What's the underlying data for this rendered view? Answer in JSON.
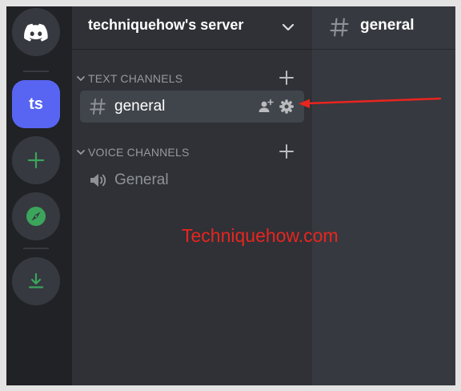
{
  "server_rail": {
    "home_icon": "discord-logo-icon",
    "servers": [
      {
        "abbreviation": "ts",
        "selected": true
      }
    ],
    "add_server_icon": "plus-icon",
    "explore_icon": "compass-icon",
    "download_icon": "download-icon"
  },
  "server": {
    "name": "techniquehow's server",
    "menu_icon": "chevron-down-icon"
  },
  "categories": [
    {
      "label": "TEXT CHANNELS",
      "channels": [
        {
          "name": "general",
          "type": "text",
          "icon": "hash-icon",
          "selected": true,
          "actions": [
            "invite-icon",
            "gear-icon"
          ]
        }
      ]
    },
    {
      "label": "VOICE CHANNELS",
      "channels": [
        {
          "name": "General",
          "type": "voice",
          "icon": "speaker-icon",
          "selected": false
        }
      ]
    }
  ],
  "main": {
    "channel_title": "general",
    "icon": "hash-icon"
  },
  "watermark": "Techniquehow.com",
  "colors": {
    "rail_bg": "#202225",
    "sidebar_bg": "#2f3136",
    "main_bg": "#36393f",
    "selected_channel_bg": "#40444b",
    "blurple": "#5865f2",
    "green": "#3ba55c",
    "annotation_red": "#e8251f"
  }
}
